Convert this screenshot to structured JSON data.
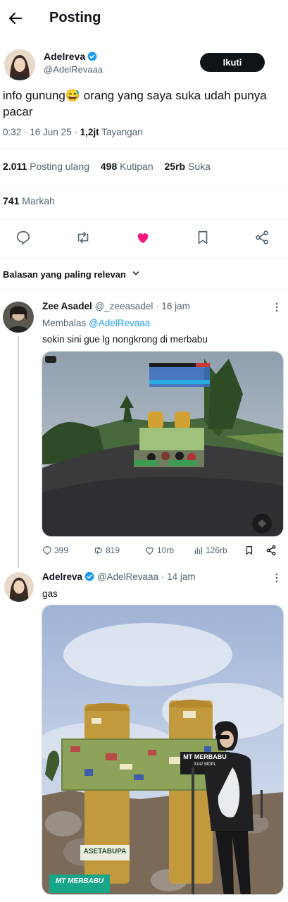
{
  "header": {
    "title": "Posting"
  },
  "post": {
    "author_name": "Adelreva",
    "author_handle": "@AdelRevaaa",
    "follow_label": "Ikuti",
    "text_a": "info gunung",
    "emoji": "😅",
    "text_b": " orang yang saya suka udah punya pacar",
    "time": "0:32 · 16 Jun 25 · ",
    "views_num": "1,2jt",
    "views_label": " Tayangan",
    "stats": {
      "reposts_num": "2.011",
      "reposts_label": "Posting ulang",
      "quotes_num": "498",
      "quotes_label": "Kutipan",
      "likes_num": "25rb",
      "likes_label": "Suka",
      "bookmarks_num": "741",
      "bookmarks_label": "Markah"
    }
  },
  "sort": {
    "label": "Balasan yang paling relevan"
  },
  "reply1": {
    "name": "Zee Asadel",
    "handle": "@_zeeasadel",
    "time": " · 16 jam",
    "replying_prefix": "Membalas ",
    "replying_to": "@AdelRevaaa",
    "text": "sokin sini gue lg nongkrong di merbabu",
    "actions": {
      "replies": "399",
      "reposts": "819",
      "likes": "10rb",
      "views": "126rb"
    }
  },
  "reply2": {
    "name": "Adelreva",
    "handle": "@AdelRevaaa",
    "time": " · 14 jam",
    "text": "gas",
    "sign_text": "MT MERBABU",
    "sign_sub": "3142 MDPL",
    "sign_bottom": "MT MERBABU",
    "stone_text": "ASETABUPA"
  },
  "colors": {
    "like": "#f91880",
    "link": "#1d9bf0",
    "verified": "#1d9bf0",
    "follow_bg": "#0f1419"
  }
}
